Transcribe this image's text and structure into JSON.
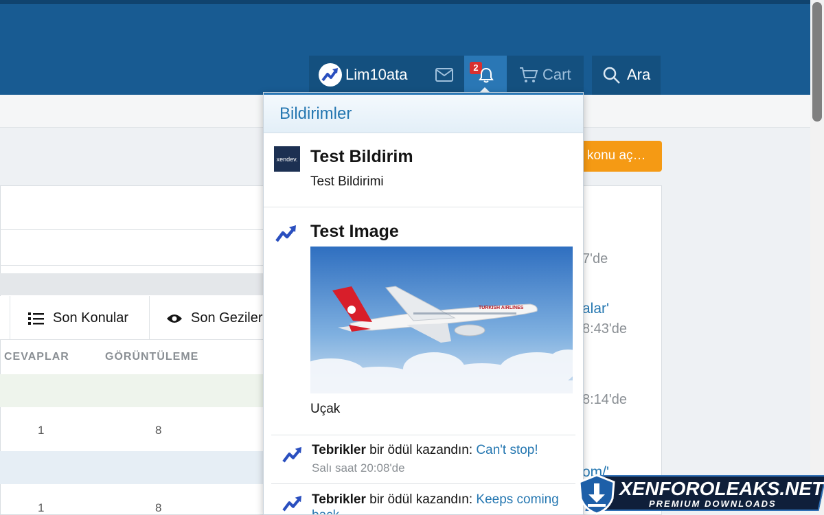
{
  "header": {
    "user": {
      "name": "Lim10ata"
    },
    "notifications_badge": "2",
    "cart_label": "Cart",
    "search_label": "Ara"
  },
  "page": {
    "new_thread_label": "konu aç…",
    "tabs": [
      {
        "label": "Son Konular",
        "icon": "list-icon"
      },
      {
        "label": "Son Geziler",
        "icon": "eye-icon"
      }
    ],
    "columns": [
      "CEVAPLAR",
      "GÖRÜNTÜLEME"
    ],
    "rows": [
      {
        "replies": "1",
        "views": "8"
      },
      {
        "replies": "1",
        "views": "8"
      }
    ],
    "right_fragments": {
      "t1": "7'de",
      "link1": "alar'",
      "t2": "8:43'de",
      "t3": "8:14'de",
      "link2": "om/'"
    }
  },
  "popup": {
    "title": "Bildirimler",
    "items": [
      {
        "title": "Test Bildirim",
        "text": "Test Bildirimi",
        "thumb_label": "xendev."
      },
      {
        "title": "Test Image",
        "caption": "Uçak",
        "image_text": "TURKISH AIRLINES"
      }
    ],
    "awards": [
      {
        "bold": "Tebrikler",
        "text": " bir ödül kazandın: ",
        "link": "Can't stop!",
        "time": "Salı saat 20:08'de"
      },
      {
        "bold": "Tebrikler",
        "text": " bir ödül kazandın: ",
        "link": "Keeps coming back",
        "time": ""
      }
    ]
  },
  "watermark": {
    "title": "XENFOROLEAKS.NET",
    "subtitle": "PREMIUM DOWNLOADS"
  },
  "colors": {
    "header": "#185b92",
    "accent_blue": "#2577b1",
    "badge_red": "#d93030",
    "button_orange": "#f59a14"
  }
}
